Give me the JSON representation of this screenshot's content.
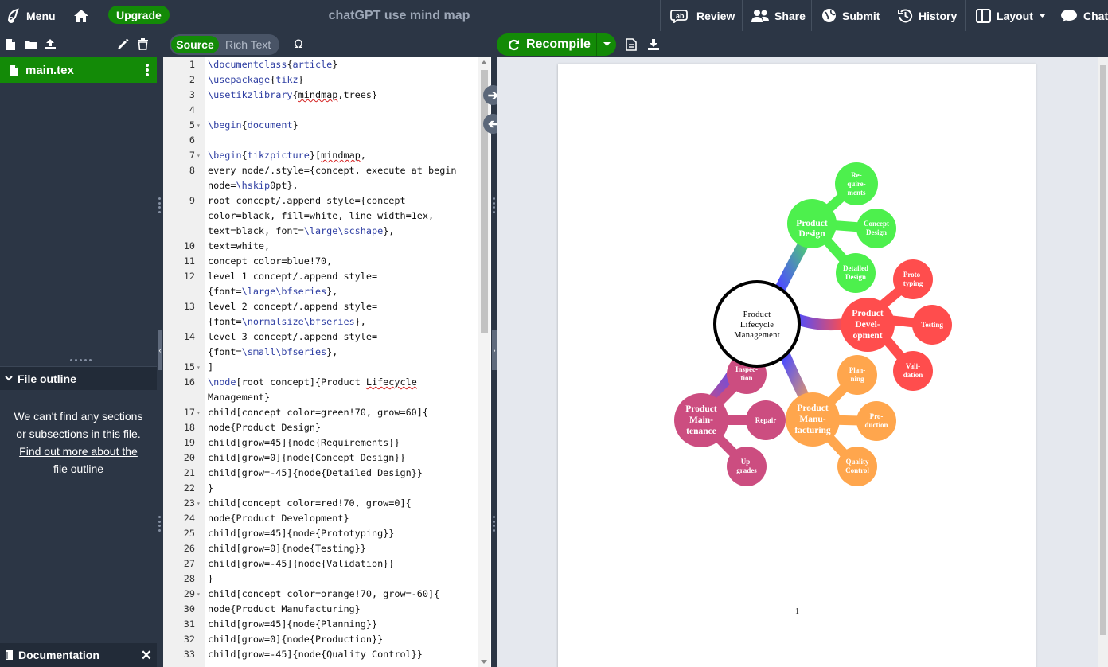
{
  "topbar": {
    "menu_label": "Menu",
    "upgrade_label": "Upgrade",
    "project_title": "chatGPT use mind map",
    "review_label": "Review",
    "share_label": "Share",
    "submit_label": "Submit",
    "history_label": "History",
    "layout_label": "Layout",
    "chat_label": "Chat"
  },
  "toolbar": {
    "source_label": "Source",
    "rich_text_label": "Rich Text",
    "recompile_label": "Recompile"
  },
  "file_tree": {
    "active_file": "main.tex"
  },
  "outline": {
    "title": "File outline",
    "empty_message": "We can't find any sections or subsections in this file.",
    "link_text": "Find out more about the file outline"
  },
  "documentation": {
    "label": "Documentation"
  },
  "editor": {
    "lines": [
      {
        "n": "1",
        "text": "\\documentclass{article}"
      },
      {
        "n": "2",
        "text": "\\usepackage{tikz}"
      },
      {
        "n": "3",
        "text": "\\usetikzlibrary{mindmap,trees}"
      },
      {
        "n": "4",
        "text": ""
      },
      {
        "n": "5",
        "text": "\\begin{document}"
      },
      {
        "n": "6",
        "text": ""
      },
      {
        "n": "7",
        "text": "\\begin{tikzpicture}[mindmap,"
      },
      {
        "n": "8",
        "text": "every node/.style={concept, execute at begin"
      },
      {
        "n": "",
        "text": "node=\\hskip0pt},"
      },
      {
        "n": "9",
        "text": "root concept/.append style={concept"
      },
      {
        "n": "",
        "text": "color=black, fill=white, line width=1ex,"
      },
      {
        "n": "",
        "text": "text=black, font=\\large\\scshape},"
      },
      {
        "n": "10",
        "text": "text=white,"
      },
      {
        "n": "11",
        "text": "concept color=blue!70,"
      },
      {
        "n": "12",
        "text": "level 1 concept/.append style="
      },
      {
        "n": "",
        "text": "{font=\\large\\bfseries},"
      },
      {
        "n": "13",
        "text": "level 2 concept/.append style="
      },
      {
        "n": "",
        "text": "{font=\\normalsize\\bfseries},"
      },
      {
        "n": "14",
        "text": "level 3 concept/.append style="
      },
      {
        "n": "",
        "text": "{font=\\small\\bfseries},"
      },
      {
        "n": "15",
        "text": "]"
      },
      {
        "n": "16",
        "text": "\\node[root concept]{Product Lifecycle"
      },
      {
        "n": "",
        "text": "Management}"
      },
      {
        "n": "17",
        "text": "child[concept color=green!70, grow=60]{"
      },
      {
        "n": "18",
        "text": "node{Product Design}"
      },
      {
        "n": "19",
        "text": "child[grow=45]{node{Requirements}}"
      },
      {
        "n": "20",
        "text": "child[grow=0]{node{Concept Design}}"
      },
      {
        "n": "21",
        "text": "child[grow=-45]{node{Detailed Design}}"
      },
      {
        "n": "22",
        "text": "}"
      },
      {
        "n": "23",
        "text": "child[concept color=red!70, grow=0]{"
      },
      {
        "n": "24",
        "text": "node{Product Development}"
      },
      {
        "n": "25",
        "text": "child[grow=45]{node{Prototyping}}"
      },
      {
        "n": "26",
        "text": "child[grow=0]{node{Testing}}"
      },
      {
        "n": "27",
        "text": "child[grow=-45]{node{Validation}}"
      },
      {
        "n": "28",
        "text": "}"
      },
      {
        "n": "29",
        "text": "child[concept color=orange!70, grow=-60]{"
      },
      {
        "n": "30",
        "text": "node{Product Manufacturing}"
      },
      {
        "n": "31",
        "text": "child[grow=45]{node{Planning}}"
      },
      {
        "n": "32",
        "text": "child[grow=0]{node{Production}}"
      },
      {
        "n": "33",
        "text": "child[grow=-45]{node{Quality Control}}"
      }
    ]
  },
  "preview": {
    "page_number": "1",
    "root": [
      "Product",
      "Lifecycle",
      "Management"
    ],
    "design": {
      "label": [
        "Product",
        "Design"
      ],
      "children": [
        [
          "Re-",
          "quire-",
          "ments"
        ],
        [
          "Concept",
          "Design"
        ],
        [
          "Detailed",
          "Design"
        ]
      ],
      "color": "#4df04d"
    },
    "development": {
      "label": [
        "Product",
        "Devel-",
        "opment"
      ],
      "children": [
        [
          "Proto-",
          "typing"
        ],
        [
          "Testing"
        ],
        [
          "Vali-",
          "dation"
        ]
      ],
      "color": "#ff4d4d"
    },
    "manufacturing": {
      "label": [
        "Product",
        "Manu-",
        "facturing"
      ],
      "children": [
        [
          "Plan-",
          "ning"
        ],
        [
          "Pro-",
          "duction"
        ],
        [
          "Quality",
          "Control"
        ]
      ],
      "color": "#ffa64d"
    },
    "maintenance": {
      "label": [
        "Product",
        "Main-",
        "tenance"
      ],
      "children": [
        [
          "Inspec-",
          "tion"
        ],
        [
          "Repair"
        ],
        [
          "Up-",
          "grades"
        ]
      ],
      "color": "#cc4d80"
    },
    "root_link_color": "#4d4dff"
  }
}
